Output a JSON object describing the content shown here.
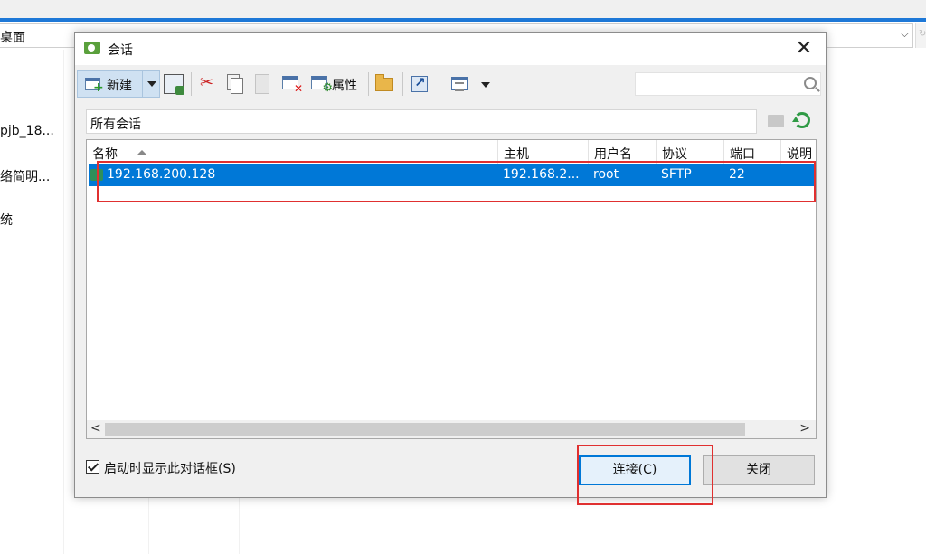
{
  "background": {
    "address_text": "桌面",
    "items": [
      "pjb_18...",
      "络简明...",
      "统"
    ]
  },
  "dialog": {
    "title": "会话",
    "toolbar": {
      "new_label": "新建",
      "properties_label": "属性",
      "search_placeholder": ""
    },
    "path": "所有会话",
    "columns": [
      "名称",
      "主机",
      "用户名",
      "协议",
      "端口",
      "说明"
    ],
    "sessions": [
      {
        "name": "192.168.200.128",
        "host": "192.168.2...",
        "user": "root",
        "protocol": "SFTP",
        "port": "22",
        "note": ""
      }
    ],
    "scroll_left": "<",
    "scroll_right": ">",
    "show_on_startup_label": "启动时显示此对话框(S)",
    "show_on_startup_checked": true,
    "connect_button": "连接(C)",
    "close_button": "关闭"
  },
  "colors": {
    "selection": "#0078d7",
    "annotation": "#e03030"
  }
}
